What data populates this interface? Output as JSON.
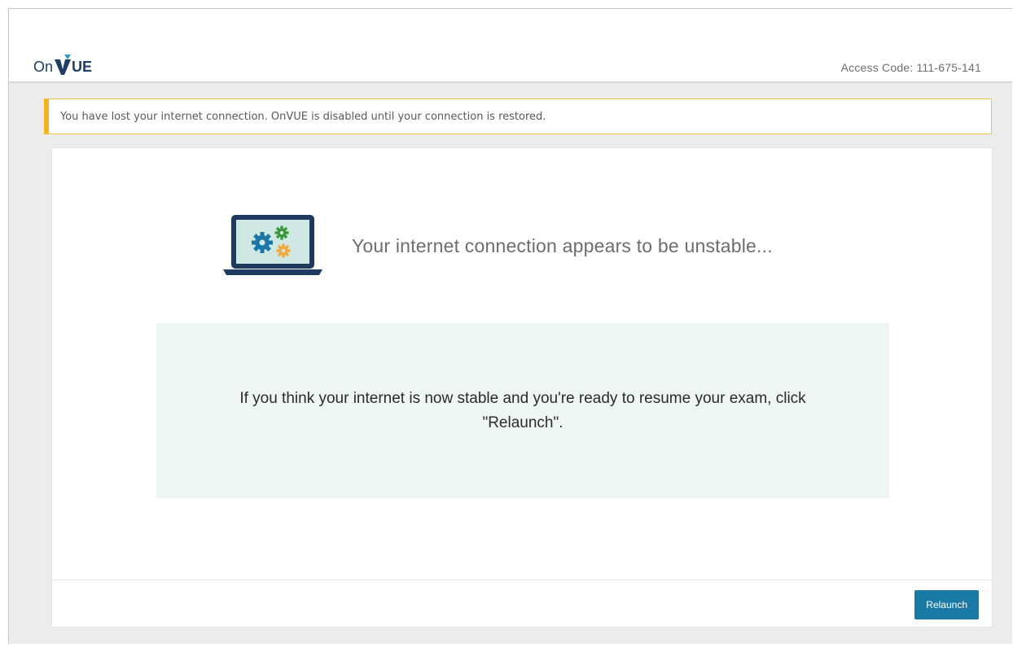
{
  "header": {
    "logo": {
      "prefix": "On",
      "suffix": "UE",
      "full_name": "OnVUE"
    },
    "access_code": "Access Code: 111-675-141"
  },
  "alert": {
    "message": "You have lost your internet connection. OnVUE is disabled until your connection is restored.",
    "color": "#f6b21b"
  },
  "main": {
    "illustration_icon": "laptop-gears-icon",
    "status_message": "Your internet connection appears to be unstable...",
    "instruction": "If you think your internet is now stable and you're ready to resume your exam, click \"Relaunch\"."
  },
  "footer": {
    "relaunch_label": "Relaunch",
    "button_color": "#1a7aa6"
  }
}
